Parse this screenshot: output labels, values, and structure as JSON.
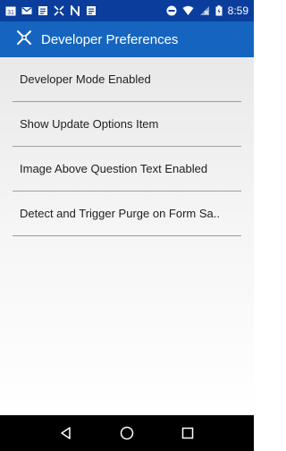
{
  "status_bar": {
    "time": "8:59",
    "left_icons": [
      "calendar-icon",
      "gmail-icon",
      "document-icon",
      "app-icon",
      "n-icon",
      "document-icon"
    ],
    "right_icons": [
      "do-not-disturb-icon",
      "wifi-icon",
      "no-sim-icon",
      "battery-icon"
    ],
    "calendar_day": "31"
  },
  "app_bar": {
    "title": "Developer Preferences",
    "icon": "app-logo-icon",
    "color": "#1565c0"
  },
  "preferences": [
    {
      "label": "Developer Mode Enabled"
    },
    {
      "label": "Show Update Options Item"
    },
    {
      "label": "Image Above Question Text Enabled"
    },
    {
      "label": "Detect and Trigger Purge on Form Sa.."
    }
  ],
  "nav_bar": {
    "back_icon": "back-triangle-icon",
    "home_icon": "home-circle-icon",
    "recents_icon": "recents-square-icon"
  }
}
